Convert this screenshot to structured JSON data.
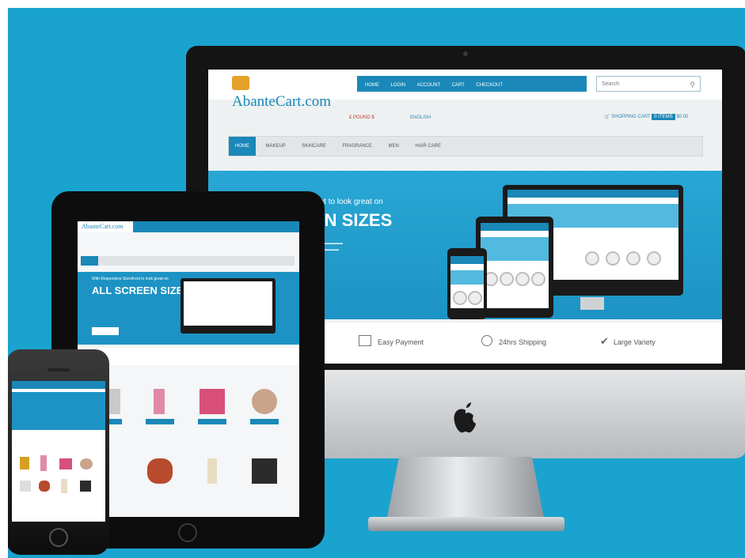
{
  "store": {
    "logo_text": "AbanteCart.com",
    "nav_items": [
      "HOME",
      "LOGIN",
      "ACCOUNT",
      "CART",
      "CHECKOUT"
    ],
    "search_placeholder": "Search",
    "currency": "£ POUND $",
    "language": "ENGLISH",
    "cart_summary": "SHOPPING CART",
    "cart_badge": "0 ITEMS",
    "cart_total": "$0.00",
    "menu_items": [
      "HOME",
      "MAKEUP",
      "SKINCARE",
      "FRAGRANCE",
      "MEN",
      "HAIR CARE"
    ],
    "banner_line1": "Storefront to look great on",
    "banner_line2": "EN SIZES",
    "features": [
      "Easy Payment",
      "24hrs Shipping",
      "Large Variety"
    ]
  },
  "tablet": {
    "logo_text": "AbanteCart.com",
    "banner_line1": "With Responsive Storefront to look great on",
    "banner_line2": "ALL SCREEN SIZES"
  },
  "brand": {
    "accent": "#1a88b8",
    "background": "#1aa3cf"
  },
  "icons": [
    "apple-logo-icon",
    "search-icon",
    "cart-icon",
    "home-icon",
    "user-icon",
    "payment-icon",
    "clock-icon",
    "checkmark-icon"
  ]
}
